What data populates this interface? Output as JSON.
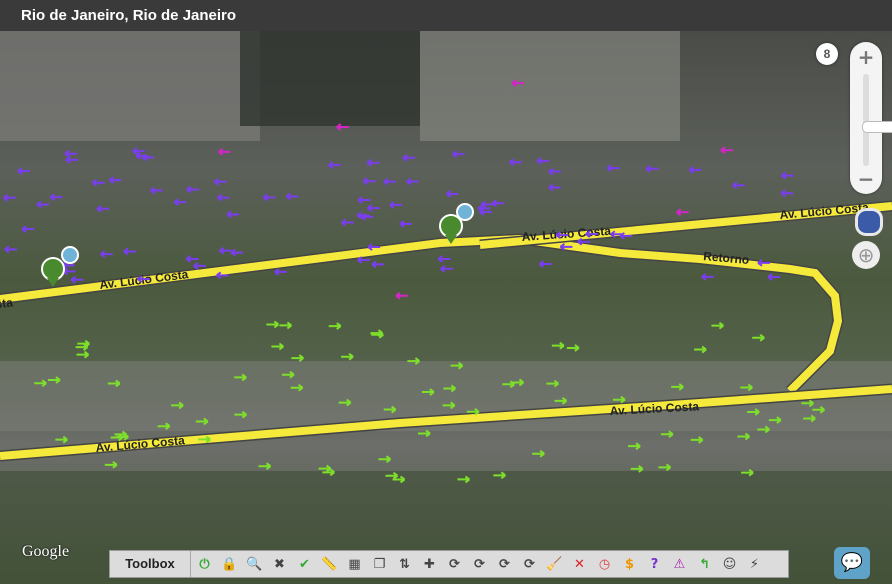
{
  "header": {
    "title": "Rio de Janeiro, Rio de Janeiro"
  },
  "map": {
    "zoom_level": "8",
    "zoom_in": "+",
    "zoom_out": "−",
    "road_labels": [
      "Av. Lúcio Costa",
      "Av. Lúcio Costa",
      "Av. Lúcio Costa",
      "Av. Lúcio Costa",
      "Av. Lúcio Costa",
      "Retorno",
      "sta"
    ],
    "attribution": "Google",
    "colors": {
      "road": "#f5ea3c",
      "road_edge": "#555",
      "arrow_purple": "#7a3df0",
      "arrow_green": "#7ddf2a",
      "arrow_magenta": "#d426c8",
      "pin": "#4a8a2e"
    }
  },
  "toolbox": {
    "label": "Toolbox",
    "tools": [
      "power-icon",
      "lock-icon",
      "search-icon",
      "tools-icon",
      "check-icon",
      "ruler-icon",
      "grid-icon",
      "copy-icon",
      "arrows-icon",
      "cross-icon",
      "roundabout-icon",
      "roundabout-icon",
      "roundabout-icon",
      "roundabout-icon",
      "broom-icon",
      "no-entry-icon",
      "clock-icon",
      "dollar-icon",
      "help-icon",
      "warning-icon",
      "turn-icon",
      "face-icon",
      "speed-icon"
    ]
  },
  "chat_icon": "chat-icon"
}
